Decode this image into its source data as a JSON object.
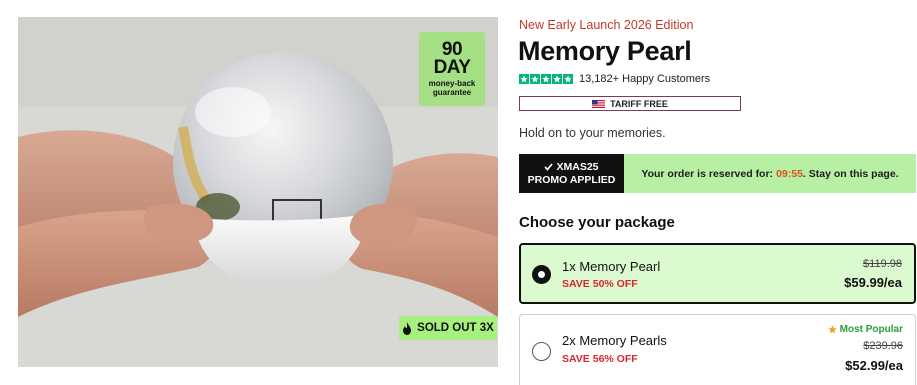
{
  "product_image": {
    "guarantee_badge": {
      "big": "90",
      "line2": "DAY",
      "line3": "money-back",
      "line4": "guarantee"
    },
    "sold_out_label": "SOLD OUT 3X",
    "icons": [
      "fire-icon"
    ]
  },
  "header": {
    "edition": "New Early Launch 2026 Edition",
    "title": "Memory Pearl",
    "rating_stars": 5,
    "review_text": "13,182+ Happy Customers",
    "tariff_label": "TARIFF FREE",
    "tagline": "Hold on to your memories."
  },
  "promo": {
    "code": "XMAS25",
    "applied_label": "PROMO APPLIED",
    "reserve_text": "Your order is reserved for:",
    "timer": "09:55",
    "reserve_suffix": ". Stay on this page."
  },
  "packages": {
    "heading": "Choose your package",
    "items": [
      {
        "name": "1x Memory Pearl",
        "save": "SAVE 50% OFF",
        "old_price": "$119.98",
        "price": "$59.99/ea",
        "selected": true,
        "badge": ""
      },
      {
        "name": "2x Memory Pearls",
        "save": "SAVE 56% OFF",
        "old_price": "$239.96",
        "price": "$52.99/ea",
        "selected": false,
        "badge": "Most Popular"
      }
    ]
  },
  "colors": {
    "accent_red": "#c0392b",
    "promo_green": "#b7f0a5",
    "selected_bg": "#dcfad0",
    "trustpilot_green": "#00b67a",
    "save_red": "#d9262e"
  }
}
